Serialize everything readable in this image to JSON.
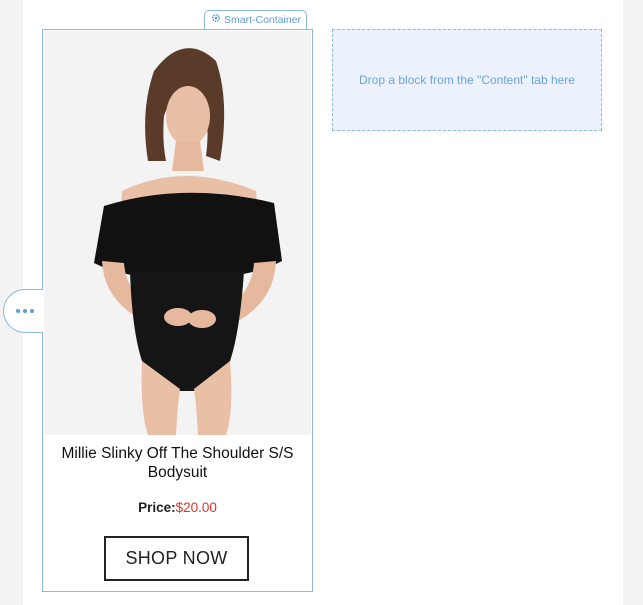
{
  "smart_container": {
    "label": "Smart-Container",
    "icon": "gear-icon"
  },
  "product": {
    "title": "Millie Slinky Off The Shoulder S/S Bodysuit",
    "price_label": "Price:",
    "price_value": "$20.00",
    "button_label": "SHOP NOW"
  },
  "handle": {
    "icon": "ellipsis-icon"
  },
  "dropzone": {
    "text": "Drop a block from the \"Content\" tab here"
  },
  "colors": {
    "accent_blue": "#5f9bd5",
    "border_blue": "#8fb8df",
    "dropzone_bg": "#ebf2fb",
    "price_red": "#e0322c"
  }
}
